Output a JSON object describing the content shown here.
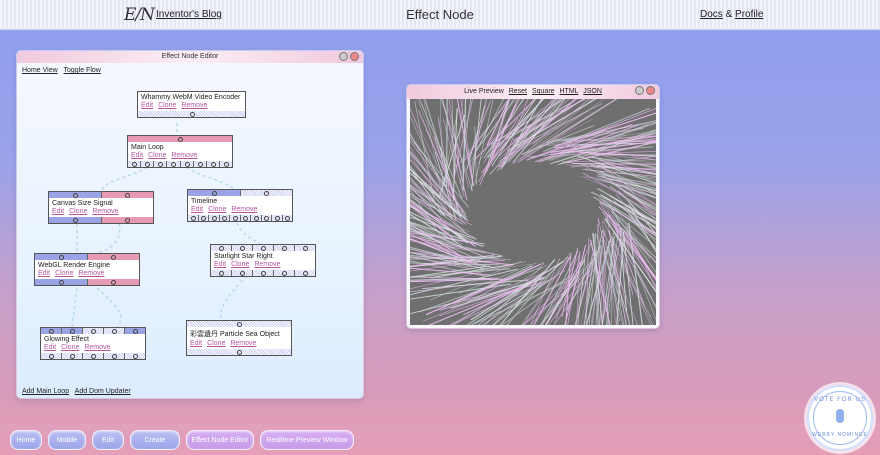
{
  "header": {
    "logo": "E/N",
    "blog_link": "Inventor's Blog",
    "title": "Effect Node",
    "docs": "Docs",
    "amp": "&",
    "profile": "Profile"
  },
  "editor": {
    "title": "Effect Node Editor",
    "home_view": "Home View",
    "toggle_flow": "Toggle Flow",
    "add_main_loop": "Add Main Loop",
    "add_dom_updater": "Add Dom Updater",
    "nodes": [
      {
        "title": "Whammy WebM Video Encoder",
        "edit": "Edit",
        "clone": "Clone",
        "remove": "Remove"
      },
      {
        "title": "Main Loop",
        "edit": "Edit",
        "clone": "Clone",
        "remove": "Remove"
      },
      {
        "title": "Canvas Size Signal",
        "edit": "Edit",
        "clone": "Clone",
        "remove": "Remove"
      },
      {
        "title": "Timeline",
        "edit": "Edit",
        "clone": "Clone",
        "remove": "Remove"
      },
      {
        "title": "WebGL Render Engine",
        "edit": "Edit",
        "clone": "Clone",
        "remove": "Remove"
      },
      {
        "title": "Starlight Star Right",
        "edit": "Edit",
        "clone": "Clone",
        "remove": "Remove"
      },
      {
        "title": "Glowing Effect",
        "edit": "Edit",
        "clone": "Clone",
        "remove": "Remove"
      },
      {
        "title": "彩雲遺丹 Particle Sea Object",
        "edit": "Edit",
        "clone": "Clone",
        "remove": "Remove"
      }
    ]
  },
  "preview": {
    "title": "Live Preview",
    "reset": "Reset",
    "square": "Square",
    "html": "HTML",
    "json": "JSON"
  },
  "dock": {
    "buttons": [
      "Home",
      "Mobile",
      "Edit",
      "Create",
      "Effect Node Editor",
      "Realtime Preview Window"
    ]
  },
  "badge": {
    "line1": "VOTE FOR US",
    "line2": "WEBBY NOMINEE"
  },
  "colors": {
    "accent_pink": "#e79ab3",
    "accent_blue": "#9aa3e3",
    "link_purple": "#b456a0"
  }
}
